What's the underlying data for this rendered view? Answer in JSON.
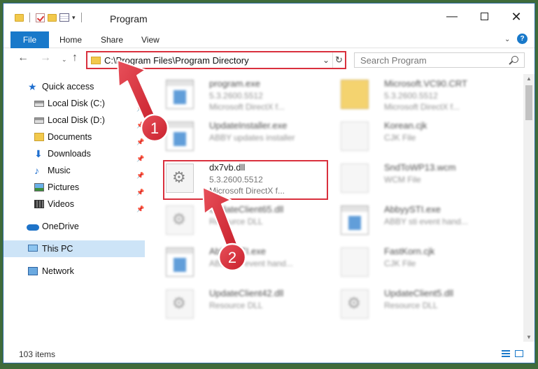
{
  "window": {
    "title": "Program",
    "controls": {
      "minimize": "—",
      "maximize": "",
      "close": "✕"
    }
  },
  "ribbon": {
    "tabs": [
      "File",
      "Home",
      "Share",
      "View"
    ],
    "chevron": "⌄",
    "help": "?"
  },
  "nav": {
    "back": "←",
    "forward": "→",
    "dropdown": "⌄",
    "up": "↑",
    "address": "C:\\Program Files\\Program Directory",
    "address_dropdown": "⌄",
    "refresh": "↻",
    "search_placeholder": "Search Program"
  },
  "sidebar": {
    "items": [
      {
        "label": "Quick access",
        "icon": "star-icon"
      },
      {
        "label": "Local Disk (C:)",
        "icon": "disk-icon"
      },
      {
        "label": "Local Disk (D:)",
        "icon": "disk-icon"
      },
      {
        "label": "Documents",
        "icon": "documents-icon"
      },
      {
        "label": "Downloads",
        "icon": "downloads-icon"
      },
      {
        "label": "Music",
        "icon": "music-icon"
      },
      {
        "label": "Pictures",
        "icon": "pictures-icon"
      },
      {
        "label": "Videos",
        "icon": "videos-icon"
      },
      {
        "label": "OneDrive",
        "icon": "onedrive-icon"
      },
      {
        "label": "This PC",
        "icon": "pc-icon"
      },
      {
        "label": "Network",
        "icon": "network-icon"
      }
    ]
  },
  "files": [
    {
      "name": "program.exe",
      "line2": "5.3.2600.5512",
      "line3": "Microsoft DirectX f...",
      "type": "exe"
    },
    {
      "name": "Microsoft.VC90.CRT",
      "line2": "5.3.2600.5512",
      "line3": "Microsoft DirectX f...",
      "type": "folder"
    },
    {
      "name": "UpdateInstaller.exe",
      "line2": "ABBY updates installer",
      "line3": "",
      "type": "exe"
    },
    {
      "name": "Korean.cjk",
      "line2": "CJK File",
      "line3": "",
      "type": "doc"
    },
    {
      "name": "dx7vb.dll",
      "line2": "5.3.2600.5512",
      "line3": "Microsoft DirectX f...",
      "type": "dll"
    },
    {
      "name": "SndToWP13.wcm",
      "line2": "WCM File",
      "line3": "",
      "type": "doc"
    },
    {
      "name": "UpdateClient65.dll",
      "line2": "Resource DLL",
      "line3": "",
      "type": "dll"
    },
    {
      "name": "AbbyySTI.exe",
      "line2": "ABBY sti event hand...",
      "line3": "",
      "type": "exe"
    },
    {
      "name": "AbbyySTI.exe",
      "line2": "ABBY sti event hand...",
      "line3": "",
      "type": "exe"
    },
    {
      "name": "FastKorn.cjk",
      "line2": "CJK File",
      "line3": "",
      "type": "doc"
    },
    {
      "name": "UpdateClient42.dll",
      "line2": "Resource DLL",
      "line3": "",
      "type": "dll"
    },
    {
      "name": "UpdateClient5.dll",
      "line2": "Resource DLL",
      "line3": "",
      "type": "dll"
    }
  ],
  "status": {
    "item_count": "103 items"
  },
  "annotations": [
    {
      "number": "1",
      "target": "address-bar"
    },
    {
      "number": "2",
      "target": "dx7vb.dll"
    }
  ],
  "colors": {
    "accent": "#1979ca",
    "highlight_red": "#d9303d",
    "selected_bg": "#cde4f7"
  }
}
